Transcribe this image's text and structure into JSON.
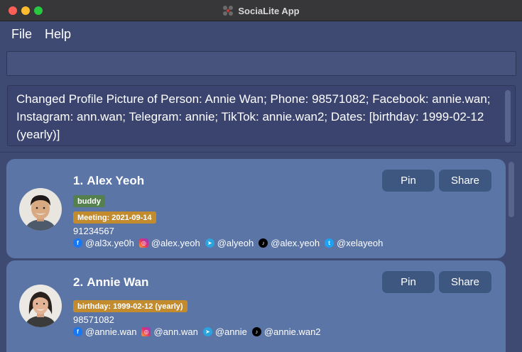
{
  "window": {
    "title": "SociaLite App"
  },
  "menu": {
    "file": "File",
    "help": "Help"
  },
  "command_box": {
    "value": ""
  },
  "result": {
    "text": "Changed Profile Picture of Person: Annie Wan; Phone: 98571082; Facebook: annie.wan; Instagram: ann.wan; Telegram: annie; TikTok: annie.wan2; Dates: [birthday: 1999-02-12 (yearly)]"
  },
  "persons": [
    {
      "index": "1.",
      "name": "Alex Yeoh",
      "tag": "buddy",
      "date": "Meeting: 2021-09-14",
      "phone": "91234567",
      "facebook": "@al3x.ye0h",
      "instagram": "@alex.yeoh",
      "telegram": "@alyeoh",
      "tiktok": "@alex.yeoh",
      "twitter": "@xelayeoh",
      "pin_label": "Pin",
      "share_label": "Share"
    },
    {
      "index": "2.",
      "name": "Annie Wan",
      "date": "birthday: 1999-02-12 (yearly)",
      "phone": "98571082",
      "facebook": "@annie.wan",
      "instagram": "@ann.wan",
      "telegram": "@annie",
      "tiktok": "@annie.wan2",
      "pin_label": "Pin",
      "share_label": "Share"
    }
  ],
  "colors": {
    "background": "#3f4a73",
    "card": "#5b75a6",
    "button": "#3e5780",
    "tag_green": "#53804d",
    "tag_orange": "#c28c2e"
  },
  "icons": {
    "facebook": "facebook-icon",
    "instagram": "instagram-icon",
    "telegram": "telegram-icon",
    "tiktok": "tiktok-icon",
    "twitter": "twitter-icon"
  }
}
